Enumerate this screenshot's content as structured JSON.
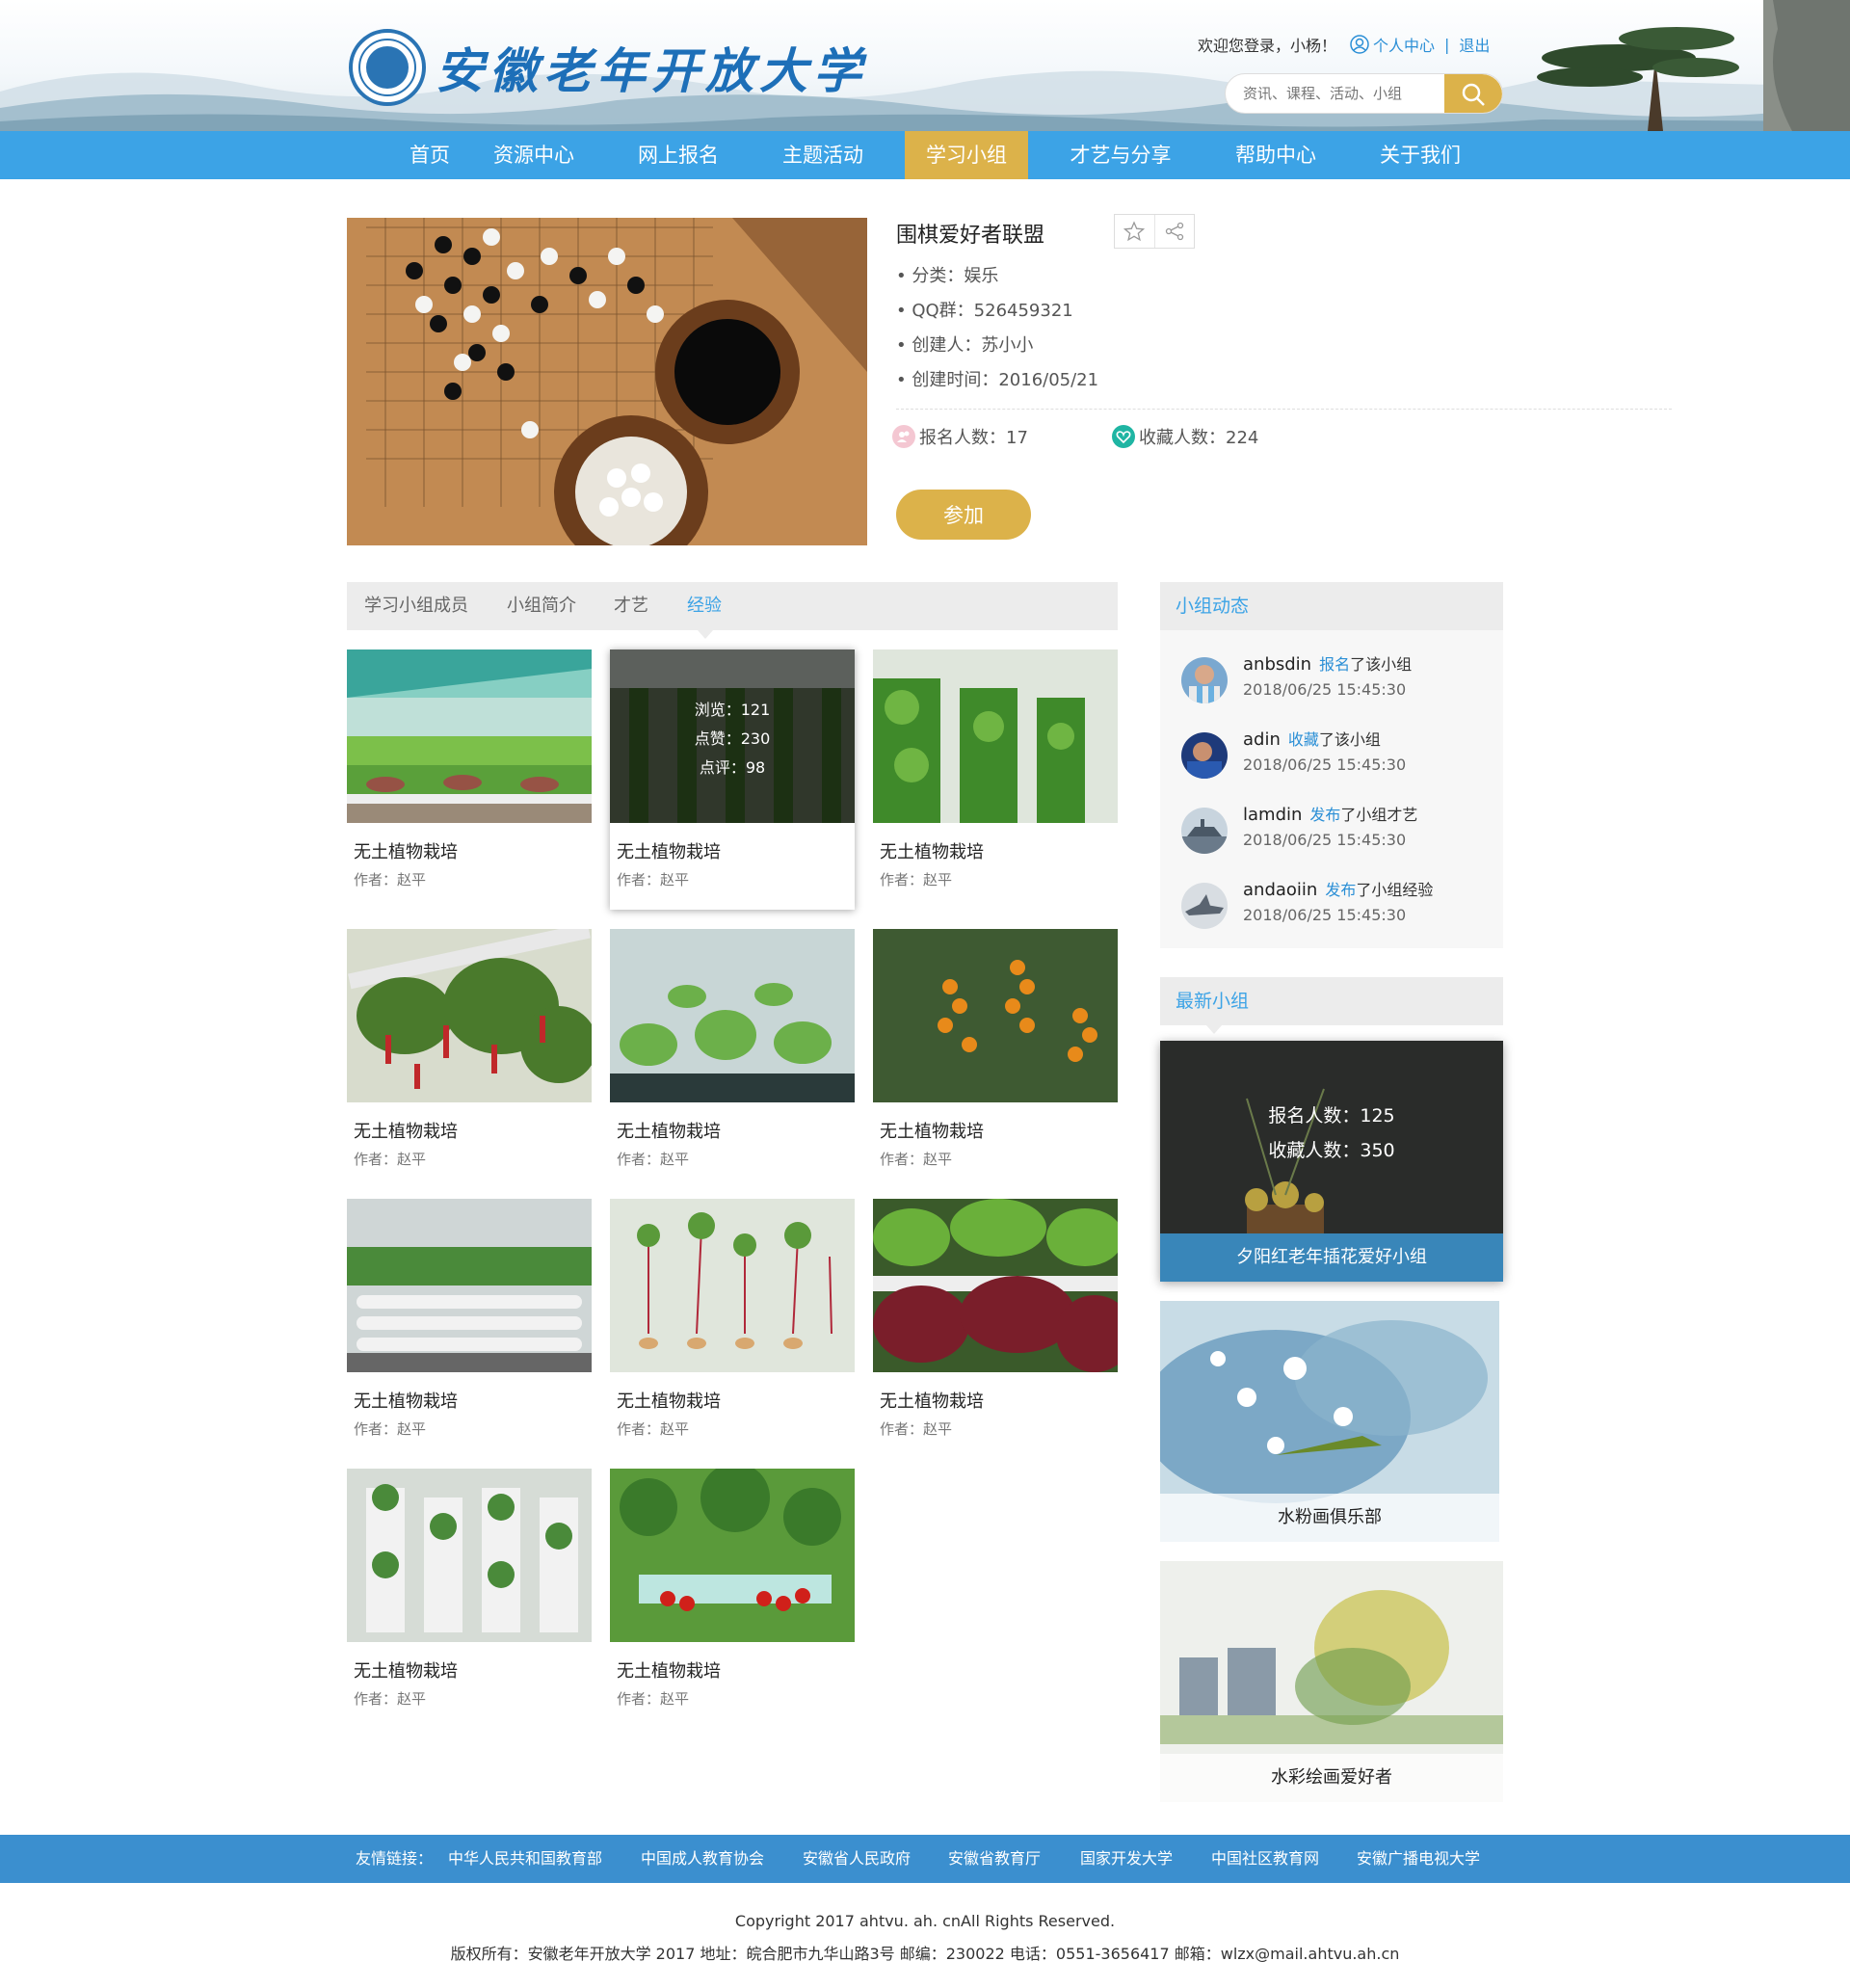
{
  "brand": {
    "name": "安徽老年开放大学"
  },
  "user": {
    "welcome": "欢迎您登录，小杨！",
    "center": "个人中心",
    "separator": "|",
    "logout": "退出"
  },
  "search": {
    "placeholder": "资讯、课程、活动、小组"
  },
  "nav": [
    {
      "label": "首页"
    },
    {
      "label": "资源中心"
    },
    {
      "label": "网上报名"
    },
    {
      "label": "主题活动"
    },
    {
      "label": "学习小组",
      "active": true
    },
    {
      "label": "才艺与分享"
    },
    {
      "label": "帮助中心"
    },
    {
      "label": "关于我们"
    }
  ],
  "group": {
    "title": "围棋爱好者联盟",
    "category": "• 分类：娱乐",
    "qq": "• QQ群：526459321",
    "creator": "• 创建人：苏小小",
    "created": "• 创建时间：2016/05/21",
    "signups": "报名人数：17",
    "favorites": "收藏人数：224",
    "join": "参加"
  },
  "tabs": [
    {
      "label": "学习小组成员"
    },
    {
      "label": "小组简介"
    },
    {
      "label": "才艺"
    },
    {
      "label": "经验",
      "active": true
    }
  ],
  "hover_stats": {
    "views": "浏览：121",
    "likes": "点赞：230",
    "comments": "点评：98"
  },
  "cards": [
    {
      "title": "无土植物栽培",
      "author": "作者：赵平"
    },
    {
      "title": "无土植物栽培",
      "author": "作者：赵平"
    },
    {
      "title": "无土植物栽培",
      "author": "作者：赵平"
    },
    {
      "title": "无土植物栽培",
      "author": "作者：赵平"
    },
    {
      "title": "无土植物栽培",
      "author": "作者：赵平"
    },
    {
      "title": "无土植物栽培",
      "author": "作者：赵平"
    },
    {
      "title": "无土植物栽培",
      "author": "作者：赵平"
    },
    {
      "title": "无土植物栽培",
      "author": "作者：赵平"
    },
    {
      "title": "无土植物栽培",
      "author": "作者：赵平"
    },
    {
      "title": "无土植物栽培",
      "author": "作者：赵平"
    },
    {
      "title": "无土植物栽培",
      "author": "作者：赵平"
    }
  ],
  "activity": {
    "title": "小组动态",
    "items": [
      {
        "name": "anbsdin",
        "action": "报名",
        "rest": "了该小组",
        "time": "2018/06/25  15:45:30"
      },
      {
        "name": "adin",
        "action": "收藏",
        "rest": "了该小组",
        "time": "2018/06/25  15:45:30"
      },
      {
        "name": "lamdin",
        "action": "发布",
        "rest": "了小组才艺",
        "time": "2018/06/25  15:45:30"
      },
      {
        "name": "andaoiin",
        "action": "发布",
        "rest": "了小组经验",
        "time": "2018/06/25  15:45:30"
      }
    ]
  },
  "newest": {
    "title": "最新小组",
    "featured": {
      "signups": "报名人数：125",
      "favorites": "收藏人数：350",
      "name": "夕阳红老年插花爱好小组"
    },
    "items": [
      {
        "name": "水粉画俱乐部"
      },
      {
        "name": "水彩绘画爱好者"
      }
    ]
  },
  "footer": {
    "links_label": "友情链接：",
    "links": [
      "中华人民共和国教育部",
      "中国成人教育协会",
      "安徽省人民政府",
      "安徽省教育厅",
      "国家开发大学",
      "中国社区教育网",
      "安徽广播电视大学"
    ],
    "copyright": "Copyright 2017 ahtvu. ah. cnAll Rights Reserved.",
    "address": "版权所有：安徽老年开放大学 2017 地址：皖合肥市九华山路3号 邮编：230022 电话：0551-3656417 邮箱：wlzx@mail.ahtvu.ah.cn"
  },
  "colors": {
    "nav": "#3ca3e6",
    "accent_gold": "#dcb24a",
    "link": "#2b8fd6",
    "footer": "#3b8fcf"
  }
}
